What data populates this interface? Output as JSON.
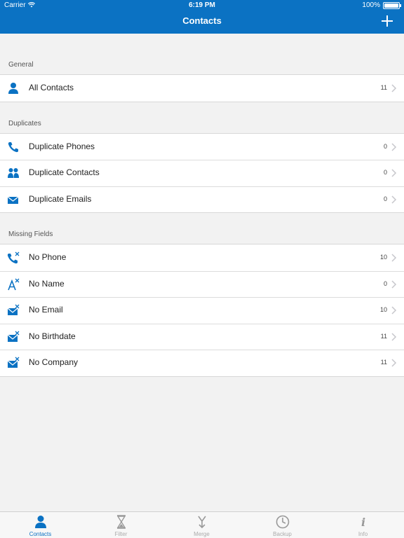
{
  "status": {
    "carrier": "Carrier",
    "time": "6:19 PM",
    "battery": "100%"
  },
  "nav": {
    "title": "Contacts"
  },
  "sections": [
    {
      "header": "General",
      "rows": [
        {
          "label": "All Contacts",
          "count": "11",
          "icon": "person-icon"
        }
      ]
    },
    {
      "header": "Duplicates",
      "rows": [
        {
          "label": "Duplicate Phones",
          "count": "0",
          "icon": "phone-icon"
        },
        {
          "label": "Duplicate Contacts",
          "count": "0",
          "icon": "people-icon"
        },
        {
          "label": "Duplicate Emails",
          "count": "0",
          "icon": "envelope-icon"
        }
      ]
    },
    {
      "header": "Missing Fields",
      "rows": [
        {
          "label": "No Phone",
          "count": "10",
          "icon": "phone-x-icon"
        },
        {
          "label": "No Name",
          "count": "0",
          "icon": "letter-a-x-icon"
        },
        {
          "label": "No Email",
          "count": "10",
          "icon": "envelope-x-icon"
        },
        {
          "label": "No Birthdate",
          "count": "11",
          "icon": "envelope-x-icon"
        },
        {
          "label": "No Company",
          "count": "11",
          "icon": "envelope-x-icon"
        }
      ]
    }
  ],
  "tabs": [
    {
      "label": "Contacts",
      "icon": "person-icon",
      "active": true
    },
    {
      "label": "Filter",
      "icon": "hourglass-icon",
      "active": false
    },
    {
      "label": "Merge",
      "icon": "merge-icon",
      "active": false
    },
    {
      "label": "Backup",
      "icon": "clock-icon",
      "active": false
    },
    {
      "label": "Info",
      "icon": "info-icon",
      "active": false
    }
  ],
  "colors": {
    "accent": "#0b72c3",
    "tab_inactive": "#aaaaaa"
  }
}
